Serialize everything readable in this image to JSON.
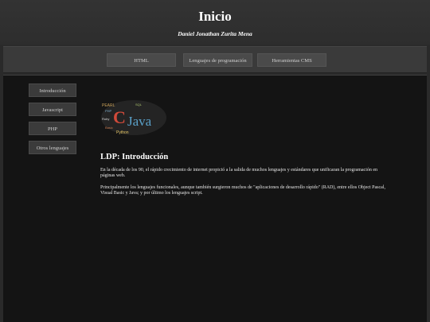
{
  "header": {
    "title": "Inicio",
    "author": "Daniel Jonathan Zurita Mena"
  },
  "topnav": {
    "items": [
      {
        "label": "HTML"
      },
      {
        "label": "Lenguajes de programación"
      },
      {
        "label": "Herramientas CMS"
      }
    ]
  },
  "sidebar": {
    "items": [
      {
        "label": "Introducción"
      },
      {
        "label": "Javascript"
      },
      {
        "label": "PHP"
      },
      {
        "label": "Otros lenguajes"
      }
    ]
  },
  "article": {
    "image_words": {
      "large": "Java",
      "letter": "C",
      "other": [
        "PEARL",
        "Python",
        "PHP",
        "SQL",
        "Ruby",
        "Basic"
      ]
    },
    "title": "LDP: Introducción",
    "paragraphs": [
      "En la década de los 90, el rápido crecimiento de internet propició a la salida de muchos lenguajes y estándares que unificaran la programación en páginas web.",
      "Principalmente los lenguajes funcionales, aunque también surgieron muchos de \"aplicaciones de desarrollo rápido\" (RAD), entre ellos Object Pascal, Visual Basic y Java; y por último los lenguajes script."
    ]
  },
  "colors": {
    "page_background": "#2a2a2a",
    "content_background": "#141414",
    "button_background": "#4a4a4a",
    "text": "#ffffff"
  }
}
